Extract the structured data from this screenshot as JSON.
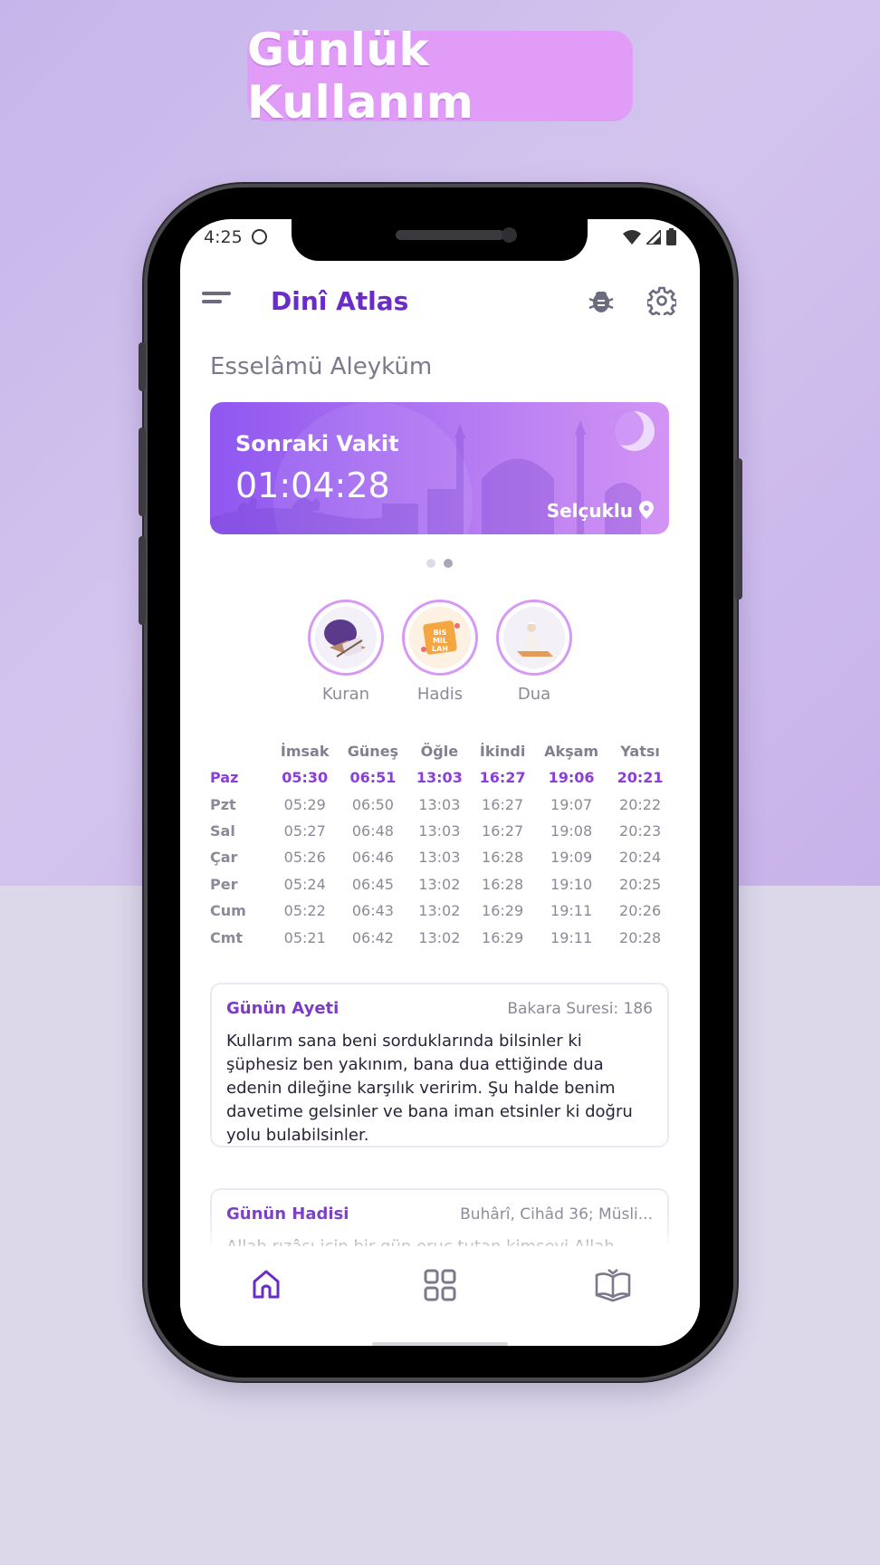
{
  "banner": {
    "title": "Günlük Kullanım"
  },
  "status_bar": {
    "time": "4:25"
  },
  "app_bar": {
    "title": "Dinî Atlas"
  },
  "greeting": "Esselâmü Aleyküm",
  "next_prayer_card": {
    "title": "Sonraki Vakit",
    "countdown": "01:04:28",
    "location": "Selçuklu"
  },
  "pager": {
    "count": 2,
    "active": 1
  },
  "shortcuts": [
    {
      "label": "Kuran",
      "icon": "quran-icon"
    },
    {
      "label": "Hadis",
      "icon": "bismillah-icon"
    },
    {
      "label": "Dua",
      "icon": "dua-icon"
    }
  ],
  "prayer_times": {
    "headers": [
      "İmsak",
      "Güneş",
      "Öğle",
      "İkindi",
      "Akşam",
      "Yatsı"
    ],
    "rows": [
      {
        "day": "Paz",
        "times": [
          "05:30",
          "06:51",
          "13:03",
          "16:27",
          "19:06",
          "20:21"
        ]
      },
      {
        "day": "Pzt",
        "times": [
          "05:29",
          "06:50",
          "13:03",
          "16:27",
          "19:07",
          "20:22"
        ]
      },
      {
        "day": "Sal",
        "times": [
          "05:27",
          "06:48",
          "13:03",
          "16:27",
          "19:08",
          "20:23"
        ]
      },
      {
        "day": "Çar",
        "times": [
          "05:26",
          "06:46",
          "13:03",
          "16:28",
          "19:09",
          "20:24"
        ]
      },
      {
        "day": "Per",
        "times": [
          "05:24",
          "06:45",
          "13:02",
          "16:28",
          "19:10",
          "20:25"
        ]
      },
      {
        "day": "Cum",
        "times": [
          "05:22",
          "06:43",
          "13:02",
          "16:29",
          "19:11",
          "20:26"
        ]
      },
      {
        "day": "Cmt",
        "times": [
          "05:21",
          "06:42",
          "13:02",
          "16:29",
          "19:11",
          "20:28"
        ]
      }
    ]
  },
  "verse_of_day": {
    "title": "Günün Ayeti",
    "reference": "Bakara Suresi: 186",
    "text": "Kullarım sana beni sorduklarında bilsinler ki şüphesiz ben yakınım, bana dua ettiğinde dua edenin dileğine karşılık veririm. Şu halde benim davetime gelsinler ve bana iman etsinler ki doğru yolu bulabilsinler."
  },
  "hadith_of_day": {
    "title": "Günün Hadisi",
    "reference": "Buhârî, Cihâd 36; Müsli...",
    "text": "Allah rızâsı için bir gün oruç tutan kimseyi Allah"
  },
  "bottom_nav": [
    {
      "name": "home",
      "icon": "home-icon"
    },
    {
      "name": "grid",
      "icon": "grid-icon"
    },
    {
      "name": "book",
      "icon": "book-icon"
    }
  ],
  "colors": {
    "accent": "#6a2bc9",
    "highlight": "#8b3fd9",
    "card_start": "#8f57f0",
    "card_end": "#d394f4",
    "banner": "#e09cf6"
  }
}
